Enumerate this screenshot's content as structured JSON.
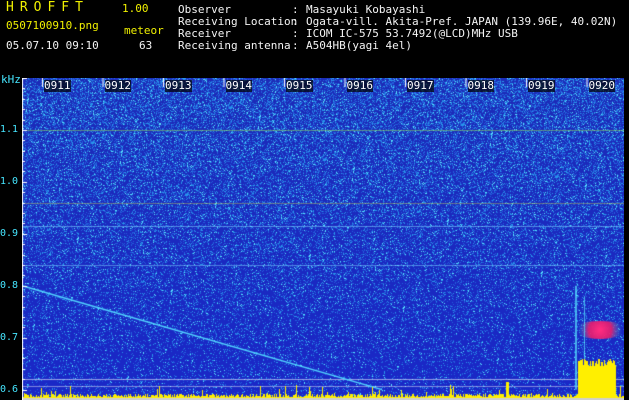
{
  "app": {
    "title": "HROFFT",
    "version": "1.00"
  },
  "file": {
    "name": "0507100910.png",
    "date_time": "05.07.10 09:10"
  },
  "detection": {
    "label": "meteor",
    "count": "63"
  },
  "station": [
    {
      "label": "Observer",
      "value": "Masayuki Kobayashi"
    },
    {
      "label": "Receiving Location",
      "value": "Ogata-vill. Akita-Pref. JAPAN (139.96E, 40.02N)"
    },
    {
      "label": "Receiver",
      "value": "ICOM IC-575 53.7492(@LCD)MHz USB"
    },
    {
      "label": "Receiving antenna",
      "value": "A504HB(yagi 4el)"
    }
  ],
  "spectrogram": {
    "unit": "kHz",
    "time_ticks": [
      "0911",
      "0912",
      "0913",
      "0914",
      "0915",
      "0916",
      "0917",
      "0918",
      "0919",
      "0920"
    ],
    "freq_ticks": [
      "1.1",
      "1.0",
      "0.9",
      "0.8",
      "0.7",
      "0.6"
    ],
    "freq_range_khz": [
      0.58,
      1.2
    ],
    "colors": {
      "background": "#1e2ec8",
      "noise": "#2a7ad8",
      "trail": "#52d6ff",
      "burst": "#ffef00",
      "echo": "#f01e6a",
      "axis": "#ffffff"
    }
  }
}
